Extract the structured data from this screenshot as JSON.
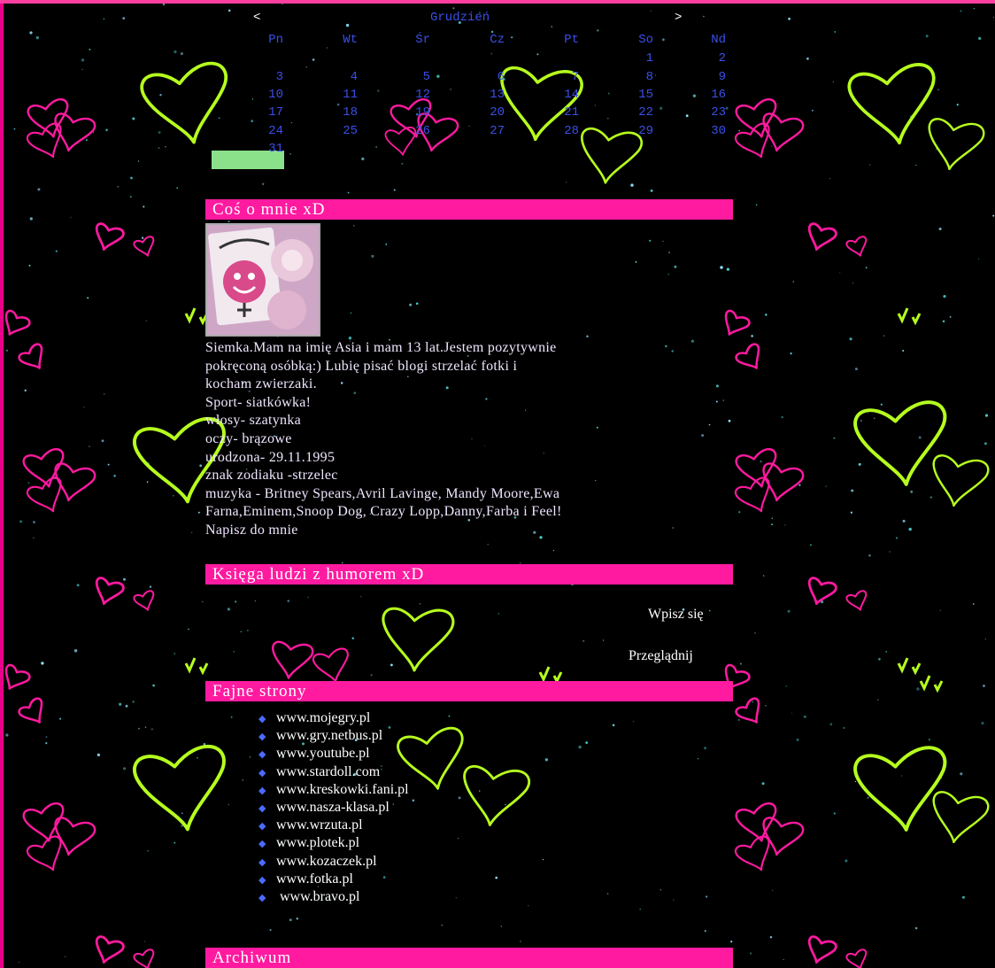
{
  "calendar": {
    "prev": "<",
    "next": ">",
    "month": "Grudzień",
    "weekdays": [
      "Pn",
      "Wt",
      "Śr",
      "Cz",
      "Pt",
      "So",
      "Nd"
    ],
    "weeks": [
      [
        "",
        "",
        "",
        "",
        "",
        "1",
        "2"
      ],
      [
        "3",
        "4",
        "5",
        "6",
        "7",
        "8",
        "9"
      ],
      [
        "10",
        "11",
        "12",
        "13",
        "14",
        "15",
        "16"
      ],
      [
        "17",
        "18",
        "19",
        "20",
        "21",
        "22",
        "23"
      ],
      [
        "24",
        "25",
        "26",
        "27",
        "28",
        "29",
        "30"
      ],
      [
        "31",
        "",
        "",
        "",
        "",
        "",
        ""
      ]
    ]
  },
  "about": {
    "title": "Coś o mnie xD",
    "lines": [
      "Siemka.Mam na imię Asia i mam 13 lat.Jestem pozytywnie",
      "pokręconą osóbką:) Lubię pisać blogi strzelać fotki i",
      "kocham zwierzaki.",
      "Sport- siatkówka!",
      "włosy- szatynka",
      "oczy- brązowe",
      "urodzona- 29.11.1995",
      "znak zodiaku -strzelec",
      "muzyka - Britney Spears,Avril Lavinge, Mandy Moore,Ewa",
      "Farna,Eminem,Snoop Dog, Crazy Lopp,Danny,Farba i Feel!"
    ],
    "contact": "Napisz do mnie"
  },
  "guestbook": {
    "title": "Księga ludzi z humorem xD",
    "sign": "Wpisz się",
    "browse": "Przeglądnij"
  },
  "links": {
    "title": "Fajne strony",
    "items": [
      "www.mojegry.pl",
      "www.gry.netbus.pl",
      "www.youtube.pl",
      "www.stardoll.com",
      "www.kreskowki.fani.pl",
      "www.nasza-klasa.pl",
      "www.wrzuta.pl",
      "www.plotek.pl",
      "www.kozaczek.pl",
      "www.fotka.pl",
      " www.bravo.pl"
    ]
  },
  "archive": {
    "title": "Archiwum"
  },
  "colors": {
    "pink": "#ff1aa0",
    "blue": "#3b4fe8",
    "lime": "#b6ff1e",
    "today": "#8be08a"
  },
  "icons": {
    "bullet": "◆"
  }
}
